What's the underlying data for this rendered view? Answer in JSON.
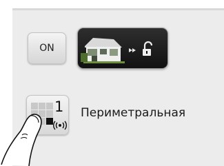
{
  "power_button": {
    "label": "ON"
  },
  "home_button": {
    "icons": [
      "house-icon",
      "fast-forward-icon",
      "unlock-icon"
    ]
  },
  "zone": {
    "number": "1",
    "name": "Периметральная",
    "icons": [
      "zone-grid-icon",
      "wireless-signal-icon"
    ]
  },
  "gesture": {
    "icon": "finger-tap-icon"
  },
  "colors": {
    "panel": "#ececec",
    "button_light": "#e4e4e4",
    "button_dark": "#1c1c1c",
    "text": "#1a1a1a"
  }
}
